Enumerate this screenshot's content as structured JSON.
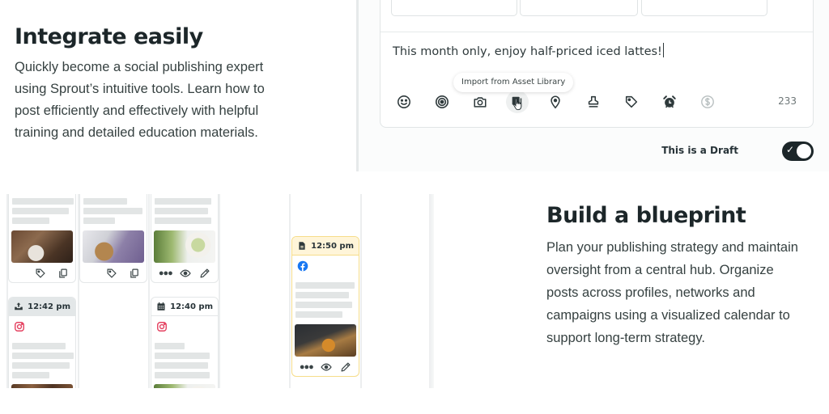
{
  "features": {
    "integrate": {
      "title": "Integrate easily",
      "body": "Quickly become a social publishing expert using Sprout’s intuitive tools. Learn how to post efficiently and effectively with helpful training and detailed education materials."
    },
    "blueprint": {
      "title": "Build a blueprint",
      "body": "Plan your publishing strategy and maintain oversight from a central hub. Organize posts across profiles, networks and campaigns using a visualized calendar to support long-term strategy."
    }
  },
  "compose": {
    "message": "This month only, enjoy half-priced iced lattes!",
    "tooltip": "Import from Asset Library",
    "character_count": "233",
    "toolbar": [
      {
        "icon": "emoji-icon",
        "label": "Emoji"
      },
      {
        "icon": "target-icon",
        "label": "Targeting"
      },
      {
        "icon": "camera-icon",
        "label": "Add media"
      },
      {
        "icon": "asset-library-icon",
        "label": "Import from Asset Library"
      },
      {
        "icon": "location-icon",
        "label": "Location"
      },
      {
        "icon": "stamp-icon",
        "label": "Approval"
      },
      {
        "icon": "tag-icon",
        "label": "Tags"
      },
      {
        "icon": "alarm-icon",
        "label": "Schedule"
      },
      {
        "icon": "dollar-icon",
        "label": "Boost"
      }
    ],
    "draft": {
      "label": "This is a Draft",
      "enabled": true
    }
  },
  "calendar": {
    "posts": [
      {
        "id": "p1",
        "image": "coffee",
        "actions": [
          "tag-icon",
          "copy-icon"
        ]
      },
      {
        "id": "p2",
        "image": "lilac",
        "actions": [
          "tag-icon",
          "copy-icon"
        ]
      },
      {
        "id": "p3",
        "image": "matcha",
        "actions": [
          "more-icon",
          "eye-icon",
          "pencil-icon"
        ]
      },
      {
        "id": "p4",
        "time": "12:42 pm",
        "status_icon": "upload-icon",
        "network": "instagram",
        "image": "pastry"
      },
      {
        "id": "p5",
        "time": "12:40 pm",
        "status_icon": "calendar-icon",
        "network": "instagram",
        "image": "matcha"
      },
      {
        "id": "p6",
        "time": "12:50 pm",
        "status_icon": "draft-doc-icon",
        "network": "facebook",
        "image": "whiskey",
        "actions": [
          "more-icon",
          "eye-icon",
          "pencil-icon"
        ]
      }
    ],
    "colors": {
      "instagram": "#e4405f",
      "facebook": "#1877f2",
      "draft_border": "#f6dd8a",
      "draft_header": "#fff5d9"
    }
  }
}
